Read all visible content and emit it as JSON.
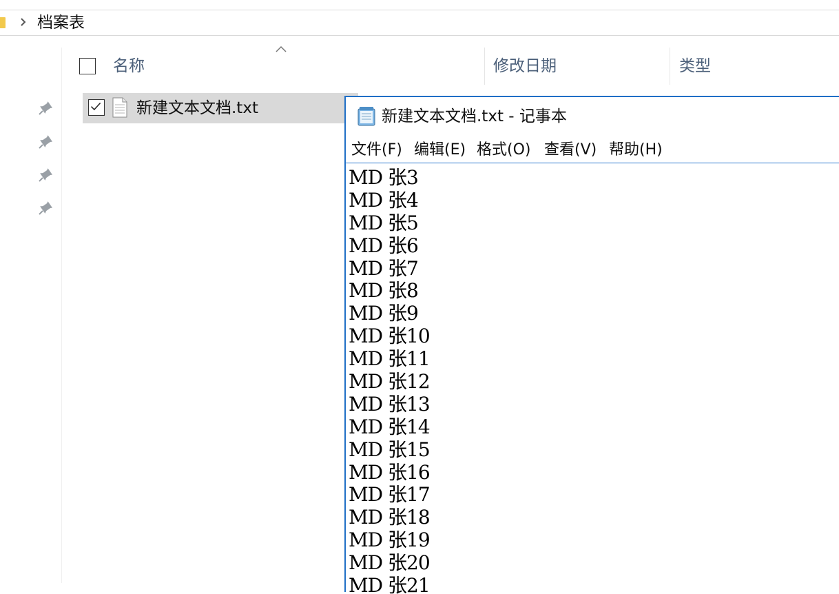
{
  "explorer": {
    "breadcrumb": [
      "档案表"
    ],
    "columns": {
      "name": "名称",
      "modified": "修改日期",
      "type": "类型"
    },
    "files": [
      {
        "name": "新建文本文档.txt",
        "selected": true,
        "icon": "text-file-icon"
      }
    ],
    "quick_access_pins": 4
  },
  "notepad": {
    "title": "新建文本文档.txt - 记事本",
    "menu": [
      "文件(F)",
      "编辑(E)",
      "格式(O)",
      "查看(V)",
      "帮助(H)"
    ],
    "lines": [
      "MD 张3",
      "MD 张4",
      "MD 张5",
      "MD 张6",
      "MD 张7",
      "MD 张8",
      "MD 张9",
      "MD 张10",
      "MD 张11",
      "MD 张12",
      "MD 张13",
      "MD 张14",
      "MD 张15",
      "MD 张16",
      "MD 张17",
      "MD 张18",
      "MD 张19",
      "MD 张20",
      "MD 张21"
    ]
  },
  "colors": {
    "accent_border": "#1f6fc6",
    "selection": "#d9d9d9",
    "header_text": "#4c607a"
  }
}
